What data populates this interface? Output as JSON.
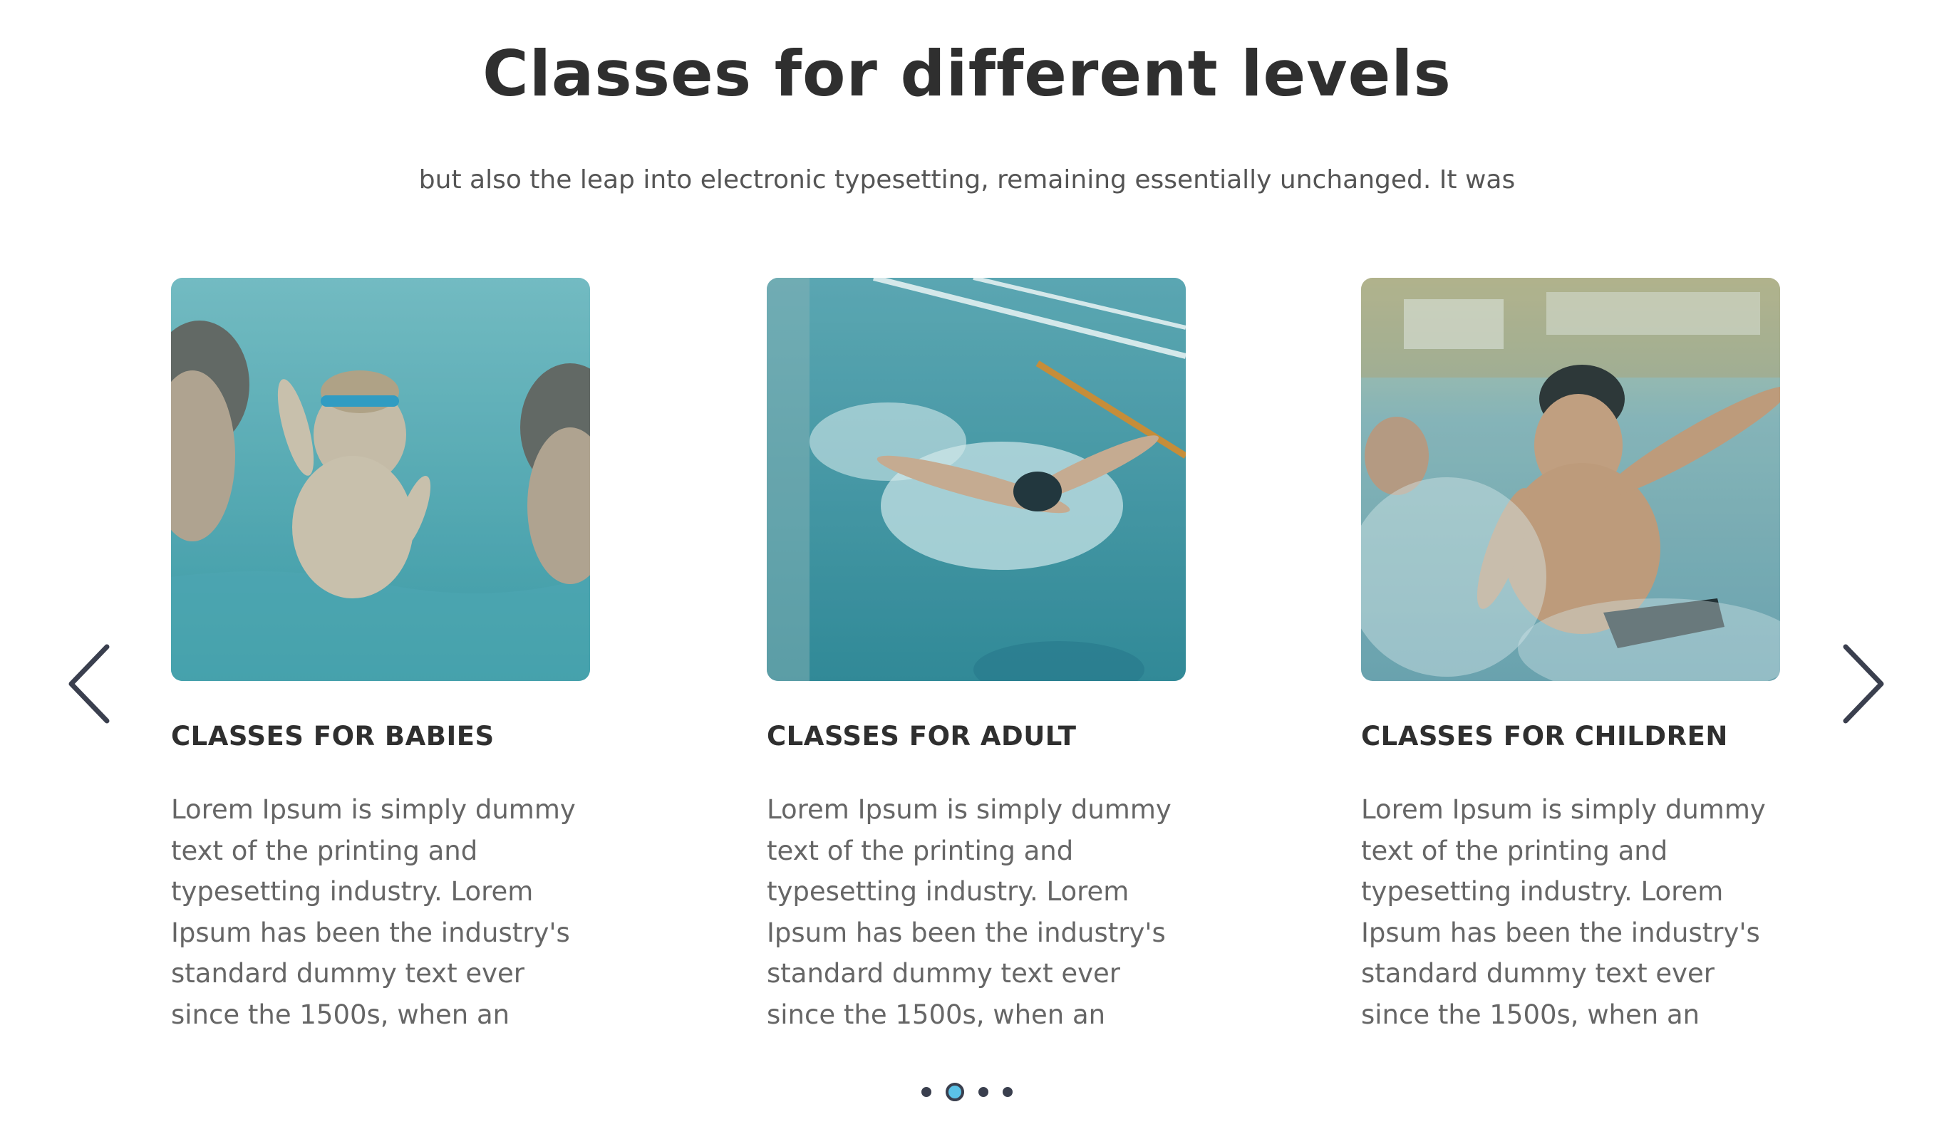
{
  "section": {
    "title": "Classes for different levels",
    "subtitle": "but also the leap into electronic typesetting, remaining essentially unchanged. It was"
  },
  "cards": [
    {
      "image_icon": "baby-swimming-photo",
      "title": "CLASSES FOR BABIES",
      "text": "Lorem Ipsum is simply dummy text of the printing and typesetting industry. Lorem Ipsum has been the industry's standard dummy text ever since the 1500s, when an"
    },
    {
      "image_icon": "adult-swimmer-photo",
      "title": "CLASSES FOR ADULT",
      "text": "Lorem Ipsum is simply dummy text of the printing and typesetting industry. Lorem Ipsum has been the industry's standard dummy text ever since the 1500s, when an"
    },
    {
      "image_icon": "child-splashing-photo",
      "title": "CLASSES FOR CHILDREN",
      "text": "Lorem Ipsum is simply dummy text of the printing and typesetting industry. Lorem Ipsum has been the industry's standard dummy text ever since the 1500s, when an"
    }
  ],
  "carousel": {
    "prev_icon": "chevron-left-icon",
    "next_icon": "chevron-right-icon",
    "dot_count": 4,
    "active_dot": 2
  },
  "colors": {
    "heading": "#2f2f2f",
    "body_text": "#666666",
    "arrow": "#3a3f4e",
    "dot_active": "#5bc2e7",
    "water_tint": "#4aa3b0"
  }
}
